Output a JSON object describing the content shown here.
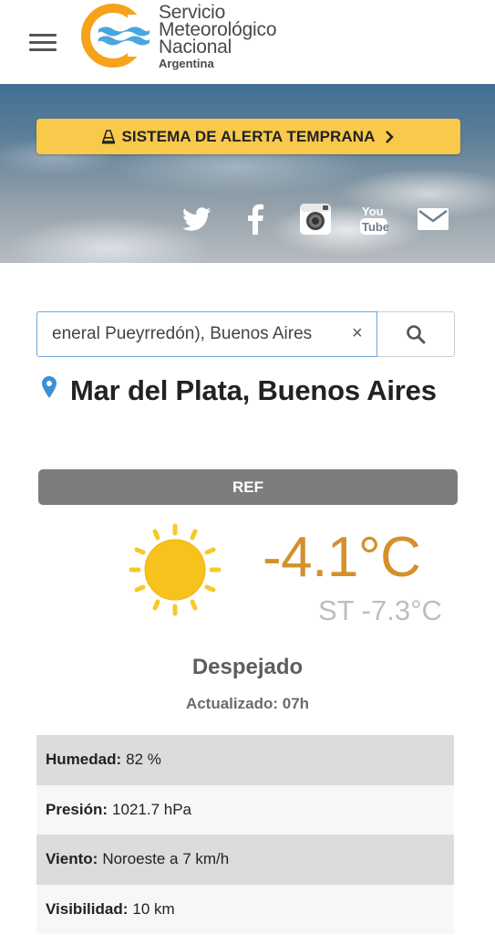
{
  "header": {
    "logo_line1": "Servicio",
    "logo_line2": "Meteorológico",
    "logo_line3": "Nacional",
    "logo_line4": "Argentina",
    "brand_colors": {
      "orange": "#f6a21a",
      "blue": "#4aa6dc"
    }
  },
  "banner": {
    "alert_label": "SISTEMA DE ALERTA TEMPRANA",
    "alert_color": "#f9c94c",
    "social": [
      "twitter-icon",
      "facebook-icon",
      "instagram-icon",
      "youtube-icon",
      "mail-icon"
    ]
  },
  "search": {
    "value": "eneral Pueyrredón), Buenos Aires",
    "clear_label": "×"
  },
  "location": {
    "name": "Mar del Plata, Buenos Aires"
  },
  "weather": {
    "station_label": "REF",
    "temperature": "-4.1°C",
    "feels_like": "ST -7.3°C",
    "condition": "Despejado",
    "updated": "Actualizado: 07h",
    "icon": "sun-icon",
    "details": [
      {
        "label": "Humedad:",
        "value": "82 %"
      },
      {
        "label": "Presión:",
        "value": "1021.7 hPa"
      },
      {
        "label": "Viento:",
        "value": "Noroeste a 7 km/h"
      },
      {
        "label": "Visibilidad:",
        "value": "10 km"
      }
    ]
  }
}
